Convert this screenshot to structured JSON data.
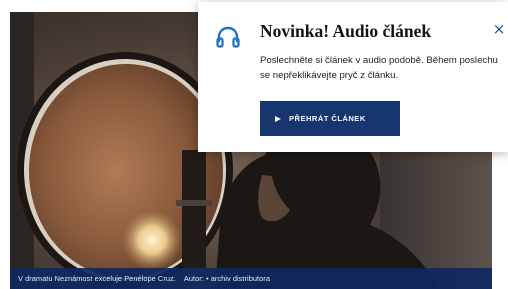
{
  "popup": {
    "title": "Novinka! Audio článek",
    "description": "Poslechněte si článek v audio podobě. Během poslechu se nepřeklikávejte pryč z článku.",
    "play_button_label": "PŘEHRÁT ČLÁNEK",
    "close_symbol": "×",
    "icon": "headphones-icon"
  },
  "caption": {
    "text": "V dramatu Neznámost exceluje Penélope Cruz.",
    "credit": "Autor: • archiv distributora"
  },
  "colors": {
    "accent": "#1f6fc4",
    "button": "#17356e",
    "caption_bar": "#0e285f"
  }
}
